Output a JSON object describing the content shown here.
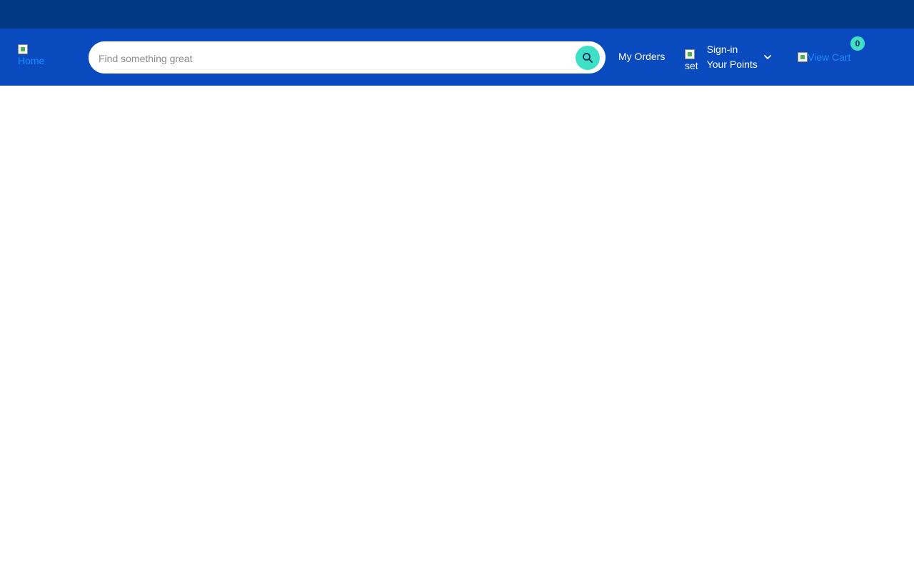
{
  "header": {
    "home_alt": "Home",
    "search": {
      "placeholder": "Find something great",
      "value": ""
    },
    "orders_label": "My Orders",
    "account": {
      "img_alt": "set",
      "signin_label": "Sign-in",
      "points_label": "Your Points"
    },
    "cart": {
      "alt": "View Cart",
      "count": "0"
    }
  },
  "colors": {
    "topbar": "#003884",
    "header": "#0a4abf",
    "accent": "#40e0c7"
  },
  "icons": {
    "search_button": "search-icon",
    "account_toggle": "chevron-down-icon"
  }
}
